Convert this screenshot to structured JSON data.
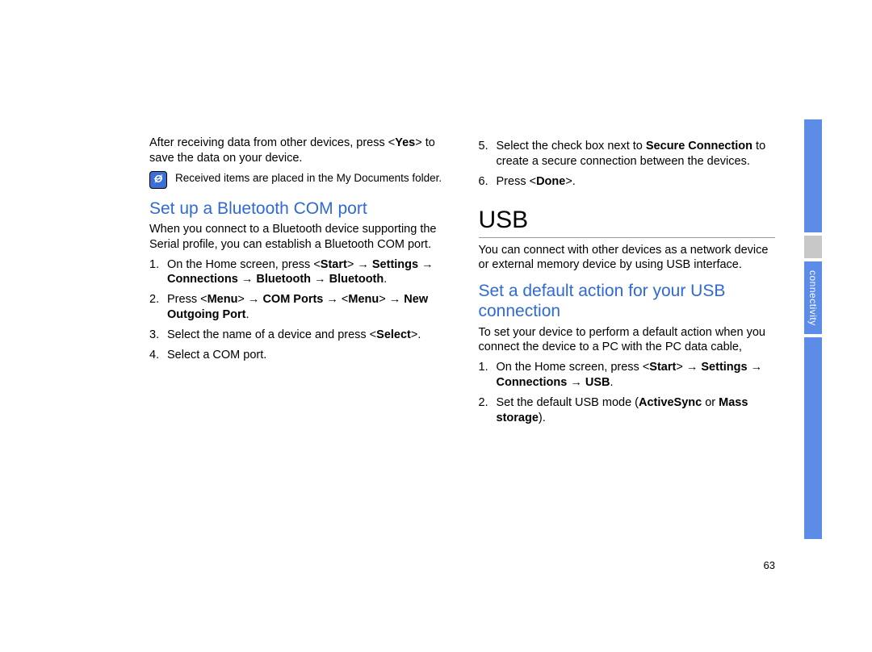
{
  "sidebar": {
    "label": "connectivity"
  },
  "pageNumber": "63",
  "left": {
    "intro": {
      "pre": "After receiving data from other devices, press <",
      "yes": "Yes",
      "post": "> to save the data on your device."
    },
    "note": "Received items are placed in the My Documents folder.",
    "heading": "Set up a Bluetooth COM port",
    "desc": "When you connect to a Bluetooth device supporting the Serial profile, you can establish a Bluetooth COM port.",
    "steps": {
      "s1a": "On the Home screen, press <",
      "s1b": "Start",
      "s1c": "> → ",
      "s1d": "Settings",
      "s1e": " → ",
      "s1f": "Connections",
      "s1g": " → ",
      "s1h": "Bluetooth",
      "s1i": " → ",
      "s1j": "Bluetooth",
      "s1k": ".",
      "s2a": "Press <",
      "s2b": "Menu",
      "s2c": "> → ",
      "s2d": "COM Ports",
      "s2e": " → <",
      "s2f": "Menu",
      "s2g": "> → ",
      "s2h": "New Outgoing Port",
      "s2i": ".",
      "s3a": "Select the name of a device and press <",
      "s3b": "Select",
      "s3c": ">.",
      "s4": "Select a COM port."
    }
  },
  "right": {
    "cont": {
      "s5a": "Select the check box next to ",
      "s5b": "Secure Connection",
      "s5c": " to create a secure connection between the devices.",
      "s6a": "Press <",
      "s6b": "Done",
      "s6c": ">."
    },
    "usbTitle": "USB",
    "usbDesc": "You can connect with other devices as a network device or external memory device by using USB interface.",
    "usbHeading": "Set a default action for your USB connection",
    "usbIntro": "To set your device to perform a default action when you connect the device to a PC with the PC data cable,",
    "usbSteps": {
      "s1a": "On the Home screen, press <",
      "s1b": "Start",
      "s1c": "> → ",
      "s1d": "Settings",
      "s1e": " → ",
      "s1f": "Connections",
      "s1g": " → ",
      "s1h": "USB",
      "s1i": ".",
      "s2a": "Set the default USB mode (",
      "s2b": "ActiveSync",
      "s2c": " or ",
      "s2d": "Mass storage",
      "s2e": ")."
    }
  }
}
